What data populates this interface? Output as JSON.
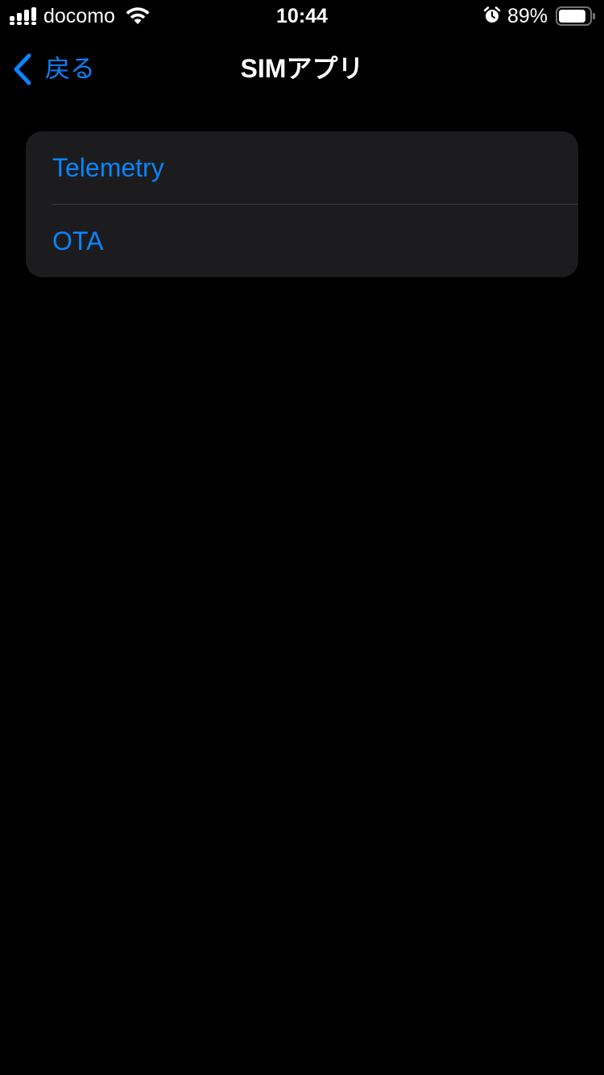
{
  "status_bar": {
    "carrier": "docomo",
    "time": "10:44",
    "battery_percent": "89%",
    "battery_level": 0.89,
    "icons": [
      "cellular-signal-icon",
      "wifi-icon",
      "alarm-icon",
      "battery-icon"
    ]
  },
  "nav": {
    "back_label": "戻る",
    "title": "SIMアプリ"
  },
  "list": {
    "items": [
      {
        "label": "Telemetry"
      },
      {
        "label": "OTA"
      }
    ]
  },
  "colors": {
    "background": "#000000",
    "group_background": "#1c1c1e",
    "accent": "#0a84ff",
    "separator": "#3a3a3c",
    "text": "#ffffff"
  }
}
